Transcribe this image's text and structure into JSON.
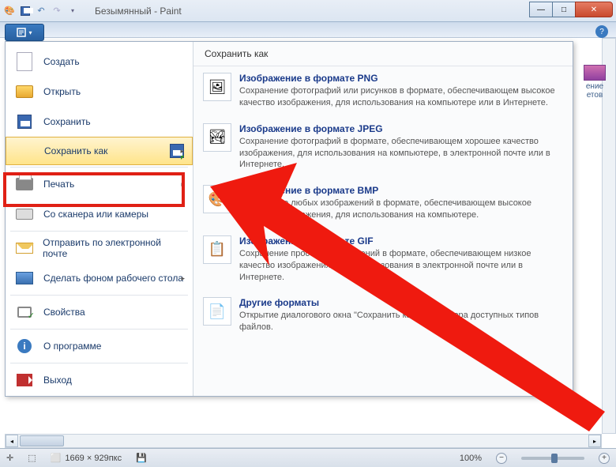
{
  "title": "Безымянный - Paint",
  "wincontrols": {
    "min": "—",
    "max": "□",
    "close": "✕"
  },
  "menu": {
    "items": [
      {
        "label": "Создать",
        "icon": "blank"
      },
      {
        "label": "Открыть",
        "icon": "folder"
      },
      {
        "label": "Сохранить",
        "icon": "floppy"
      },
      {
        "label": "Сохранить как",
        "icon": "floppy-arrow",
        "arrow": true,
        "hover": true
      },
      {
        "label": "Печать",
        "icon": "print",
        "arrow": true
      },
      {
        "label": "Со сканера или камеры",
        "icon": "scan"
      },
      {
        "label": "Отправить по электронной почте",
        "icon": "mail"
      },
      {
        "label": "Сделать фоном рабочего стола",
        "icon": "desk",
        "arrow": true
      },
      {
        "label": "Свойства",
        "icon": "props"
      },
      {
        "label": "О программе",
        "icon": "info"
      },
      {
        "label": "Выход",
        "icon": "exit"
      }
    ]
  },
  "submenu": {
    "title": "Сохранить как",
    "items": [
      {
        "title": "Изображение в формате PNG",
        "desc": "Сохранение фотографий или рисунков в формате, обеспечивающем высокое качество изображения, для использования на компьютере или в Интернете.",
        "icon": "🖼"
      },
      {
        "title": "Изображение в формате JPEG",
        "desc": "Сохранение фотографий в формате, обеспечивающем хорошее качество изображения, для использования на компьютере, в электронной почте или в Интернете.",
        "icon": "🏞"
      },
      {
        "title": "Изображение в формате BMP",
        "desc": "Сохранение любых изображений в формате, обеспечивающем высокое качество изображения, для использования на компьютере.",
        "icon": "🎨"
      },
      {
        "title": "Изображение в формате GIF",
        "desc": "Сохранение простых изображений в формате, обеспечивающем низкое качество изображения, для использования в электронной почте или в Интернете.",
        "icon": "📋"
      },
      {
        "title": "Другие форматы",
        "desc": "Открытие диалогового окна \"Сохранить как\" для выбора доступных типов файлов.",
        "icon": "📄"
      }
    ]
  },
  "behind": {
    "label": "ение\nетов"
  },
  "status": {
    "coords": "",
    "size": "1669 × 929пкс",
    "zoom": "100%"
  }
}
